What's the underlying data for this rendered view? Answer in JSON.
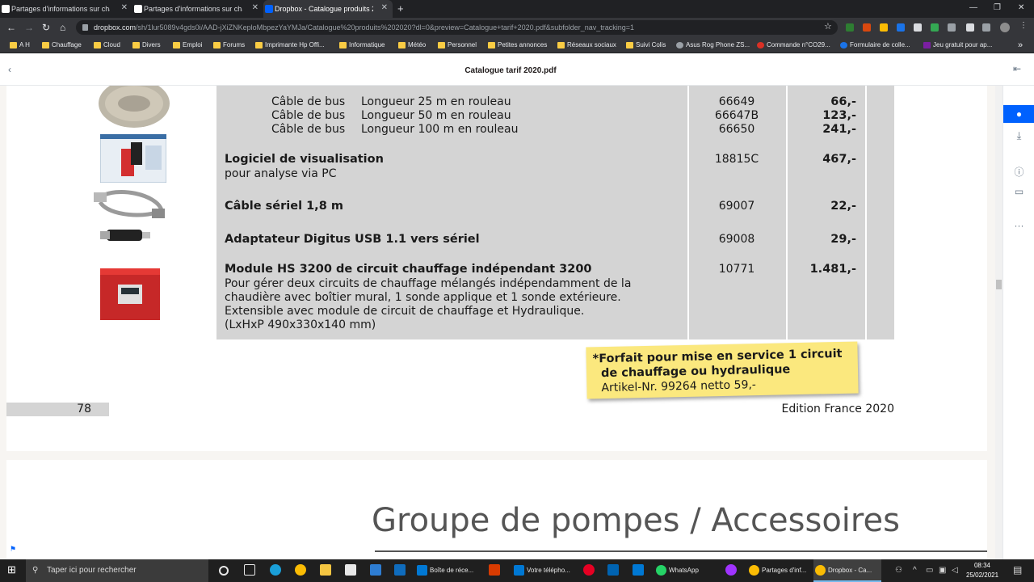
{
  "browser": {
    "tabs": [
      {
        "label": "Partages d'informations sur chauffage"
      },
      {
        "label": "Partages d'informations sur chauffage"
      },
      {
        "label": "Dropbox - Catalogue produits 2020"
      }
    ],
    "url_host": "dropbox.com",
    "url_path": "/sh/1lur5089v4gds0i/AAD-jXiZNKeploMbpezYaYMJa/Catalogue%20produits%202020?dl=0&preview=Catalogue+tarif+2020.pdf&subfolder_nav_tracking=1",
    "bookmarks": [
      "A H",
      "Chauffage",
      "Cloud",
      "Divers",
      "Emploi",
      "Forums",
      "Imprimante Hp Offi...",
      "Informatique",
      "Météo",
      "Personnel",
      "Petites annonces",
      "Réseaux sociaux",
      "Suivi Colis",
      "Asus Rog Phone ZS...",
      "Commande n°CO29...",
      "Formulaire de colle...",
      "Jeu gratuit pour ap..."
    ]
  },
  "viewer": {
    "title": "Catalogue tarif 2020.pdf"
  },
  "catalog": {
    "cable_rows": [
      {
        "name": "Câble de bus",
        "length": "Longueur 25 m en rouleau",
        "ref": "66649",
        "price": "66,-"
      },
      {
        "name": "Câble de bus",
        "length": "Longueur 50 m en rouleau",
        "ref": "66647B",
        "price": "123,-"
      },
      {
        "name": "Câble de bus",
        "length": "Longueur 100 m en rouleau",
        "ref": "66650",
        "price": "241,-"
      }
    ],
    "products": [
      {
        "name": "Logiciel de visualisation",
        "desc": [
          "pour analyse via PC"
        ],
        "ref": "18815C",
        "price": "467,-"
      },
      {
        "name": "Câble sériel 1,8 m",
        "desc": [],
        "ref": "69007",
        "price": "22,-"
      },
      {
        "name": "Adaptateur Digitus USB 1.1 vers sériel",
        "desc": [],
        "ref": "69008",
        "price": "29,-"
      },
      {
        "name": "Module HS 3200 de circuit chauffage indépendant 3200",
        "desc": [
          "Pour gérer deux circuits de chauffage mélangés indépendamment de la",
          "chaudière avec boîtier mural, 1 sonde applique et 1 sonde extérieure.",
          "Extensible avec module de circuit de chauffage et Hydraulique.",
          "(LxHxP 490x330x140 mm)"
        ],
        "ref": "10771",
        "price": "1.481,-"
      }
    ],
    "note": {
      "line1": "*Forfait pour mise en service 1 circuit",
      "line2": "de chauffage ou hydraulique",
      "line3": "Artikel-Nr. 99264 netto  59,-"
    },
    "page_number": "78",
    "edition": "Edition France 2020",
    "next_page_title": "Groupe de pompes / Accessoires"
  },
  "taskbar": {
    "search_placeholder": "Taper ici pour rechercher",
    "apps": [
      "Boîte de réce...",
      "Votre téléphо...",
      "WhatsApp",
      "Partages d'inf...",
      "Dropbox - Ca..."
    ],
    "time": "08:34",
    "date": "25/02/2021"
  }
}
